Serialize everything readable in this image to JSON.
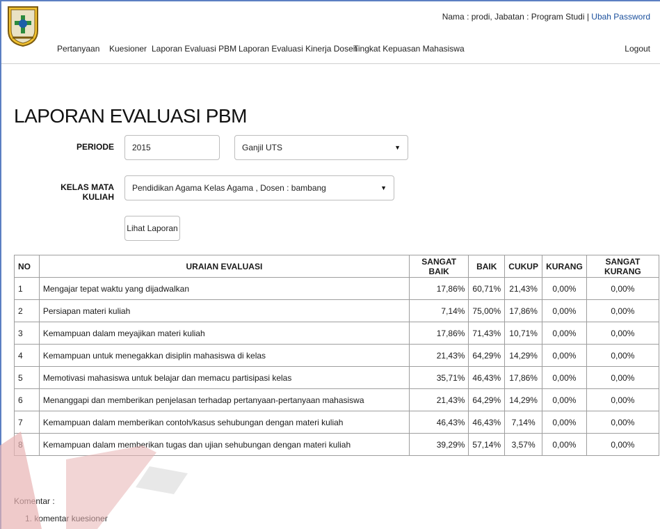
{
  "header": {
    "user_prefix": "Nama : prodi, Jabatan : Program Studi | ",
    "change_password": "Ubah Password",
    "logout": "Logout",
    "nav": [
      "Pertanyaan",
      "Kuesioner",
      "Laporan Evaluasi PBM",
      "Laporan Evaluasi Kinerja Dosen",
      "Tingkat Kepuasan Mahasiswa"
    ]
  },
  "page_title": "LAPORAN EVALUASI PBM",
  "form": {
    "periode_label": "PERIODE",
    "periode_value": "2015",
    "semester_value": "Ganjil UTS",
    "kelas_label": "KELAS MATA KULIAH",
    "kelas_value": "Pendidikan Agama Kelas Agama , Dosen : bambang",
    "submit_label": "Lihat Laporan"
  },
  "table": {
    "headers": [
      "NO",
      "URAIAN EVALUASI",
      "SANGAT BAIK",
      "BAIK",
      "CUKUP",
      "KURANG",
      "SANGAT KURANG"
    ],
    "rows": [
      {
        "no": "1",
        "uraian": "Mengajar tepat waktu yang dijadwalkan",
        "sangat_baik": "17,86%",
        "baik": "60,71%",
        "cukup": "21,43%",
        "kurang": "0,00%",
        "sangat_kurang": "0,00%"
      },
      {
        "no": "2",
        "uraian": "Persiapan materi kuliah",
        "sangat_baik": "7,14%",
        "baik": "75,00%",
        "cukup": "17,86%",
        "kurang": "0,00%",
        "sangat_kurang": "0,00%"
      },
      {
        "no": "3",
        "uraian": "Kemampuan dalam meyajikan materi kuliah",
        "sangat_baik": "17,86%",
        "baik": "71,43%",
        "cukup": "10,71%",
        "kurang": "0,00%",
        "sangat_kurang": "0,00%"
      },
      {
        "no": "4",
        "uraian": "Kemampuan untuk menegakkan disiplin mahasiswa di kelas",
        "sangat_baik": "21,43%",
        "baik": "64,29%",
        "cukup": "14,29%",
        "kurang": "0,00%",
        "sangat_kurang": "0,00%"
      },
      {
        "no": "5",
        "uraian": "Memotivasi mahasiswa untuk belajar dan memacu partisipasi kelas",
        "sangat_baik": "35,71%",
        "baik": "46,43%",
        "cukup": "17,86%",
        "kurang": "0,00%",
        "sangat_kurang": "0,00%"
      },
      {
        "no": "6",
        "uraian": "Menanggapi dan memberikan penjelasan terhadap pertanyaan-pertanyaan mahasiswa",
        "sangat_baik": "21,43%",
        "baik": "64,29%",
        "cukup": "14,29%",
        "kurang": "0,00%",
        "sangat_kurang": "0,00%"
      },
      {
        "no": "7",
        "uraian": "Kemampuan dalam memberikan contoh/kasus sehubungan dengan materi kuliah",
        "sangat_baik": "46,43%",
        "baik": "46,43%",
        "cukup": "7,14%",
        "kurang": "0,00%",
        "sangat_kurang": "0,00%"
      },
      {
        "no": "8",
        "uraian": "Kemampuan dalam memberikan tugas dan ujian sehubungan dengan materi kuliah",
        "sangat_baik": "39,29%",
        "baik": "57,14%",
        "cukup": "3,57%",
        "kurang": "0,00%",
        "sangat_kurang": "0,00%"
      }
    ]
  },
  "komentar": {
    "label": "Komentar :",
    "items": [
      "1.  komentar kuesioner"
    ]
  },
  "colors": {
    "link": "#1a4f9c",
    "frame": "#5b7fc2",
    "border": "#9e9e9e",
    "watermark_red": "#e8b3b3",
    "watermark_gray": "#d9d9d9"
  },
  "icons": {
    "logo": "university-logo",
    "caret": "caret-down-icon"
  }
}
